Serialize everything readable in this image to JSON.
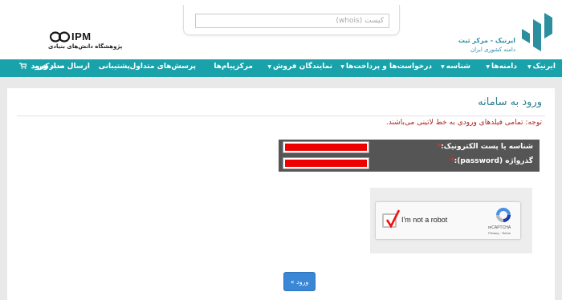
{
  "header": {
    "whois_placeholder": "کیست (whois)",
    "ipm_logo_text": "IPM",
    "ipm_subtitle": "پژوهشگاه دانش‌های بنیادی",
    "irnic_title": "ایرنیک - مرکز ثبت",
    "irnic_subtitle": "دامنه کشوری ایران"
  },
  "nav": {
    "items": [
      {
        "label": "ایرنیک",
        "dropdown": true
      },
      {
        "label": "دامنه‌ها",
        "dropdown": true
      },
      {
        "label": "شناسه",
        "dropdown": true
      },
      {
        "label": "درخواست‌ها و پرداخت‌ها",
        "dropdown": true
      },
      {
        "label": "نمایندگان فروش",
        "dropdown": true
      },
      {
        "label": "مرکزپیام‌ها",
        "dropdown": false
      },
      {
        "label": "پرسش‌های متداول",
        "dropdown": false
      },
      {
        "label": "پشتیبانی",
        "dropdown": false
      },
      {
        "label": "ارسال مدارک",
        "dropdown": false
      },
      {
        "label": "سبد خرید",
        "dropdown": false
      },
      {
        "label": "ورود",
        "dropdown": false
      }
    ]
  },
  "login": {
    "title": "ورود به سامانه",
    "notice": "توجه: تمامی فیلدهای ورودی به خط لاتینی می‌باشند.",
    "handle_label": "شناسه یا پست الکترونیک:",
    "password_label": "گذرواژه (password):",
    "required_mark": "*",
    "submit_label": "ورود »"
  },
  "captcha": {
    "label": "I'm not a robot",
    "brand": "reCAPTCHA",
    "links": "Privacy - Terms",
    "checked": true
  },
  "colors": {
    "nav_bg": "#1aa2ab",
    "title": "#2e7f8f",
    "notice": "#b02020",
    "form_bg": "#555555",
    "field_fill": "#ee0000",
    "button": "#3a87d6"
  }
}
